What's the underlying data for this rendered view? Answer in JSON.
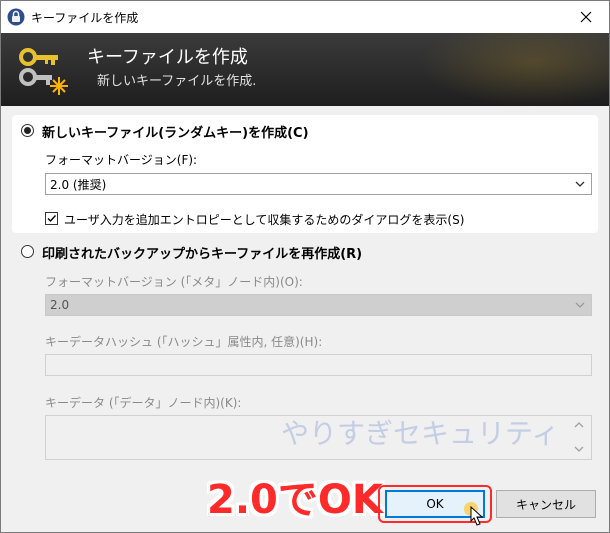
{
  "window": {
    "title": "キーファイルを作成"
  },
  "banner": {
    "title": "キーファイルを作成",
    "subtitle": "新しいキーファイルを作成."
  },
  "create_new": {
    "label": "新しいキーファイル(ランダムキー)を作成(C)",
    "selected": true,
    "format_label": "フォーマットバージョン(F):",
    "format_value": "2.0 (推奨)",
    "entropy_checkbox_label": "ユーザ入力を追加エントロピーとして収集するためのダイアログを表示(S)",
    "entropy_checked": true
  },
  "recreate": {
    "label": "印刷されたバックアップからキーファイルを再作成(R)",
    "selected": false,
    "format_label": "フォーマットバージョン (「メタ」ノード内)(O):",
    "format_value": "2.0",
    "hash_label": "キーデータハッシュ (「ハッシュ」属性内, 任意)(H):",
    "hash_value": "",
    "data_label": "キーデータ (「データ」ノード内)(K):",
    "data_value": ""
  },
  "watermark": "やりすぎセキュリティ",
  "annotation": "2.0でOK",
  "buttons": {
    "ok": "OK",
    "cancel": "キャンセル"
  },
  "colors": {
    "annotation_red": "#ff2a2a",
    "focus_blue": "#0078d7"
  }
}
